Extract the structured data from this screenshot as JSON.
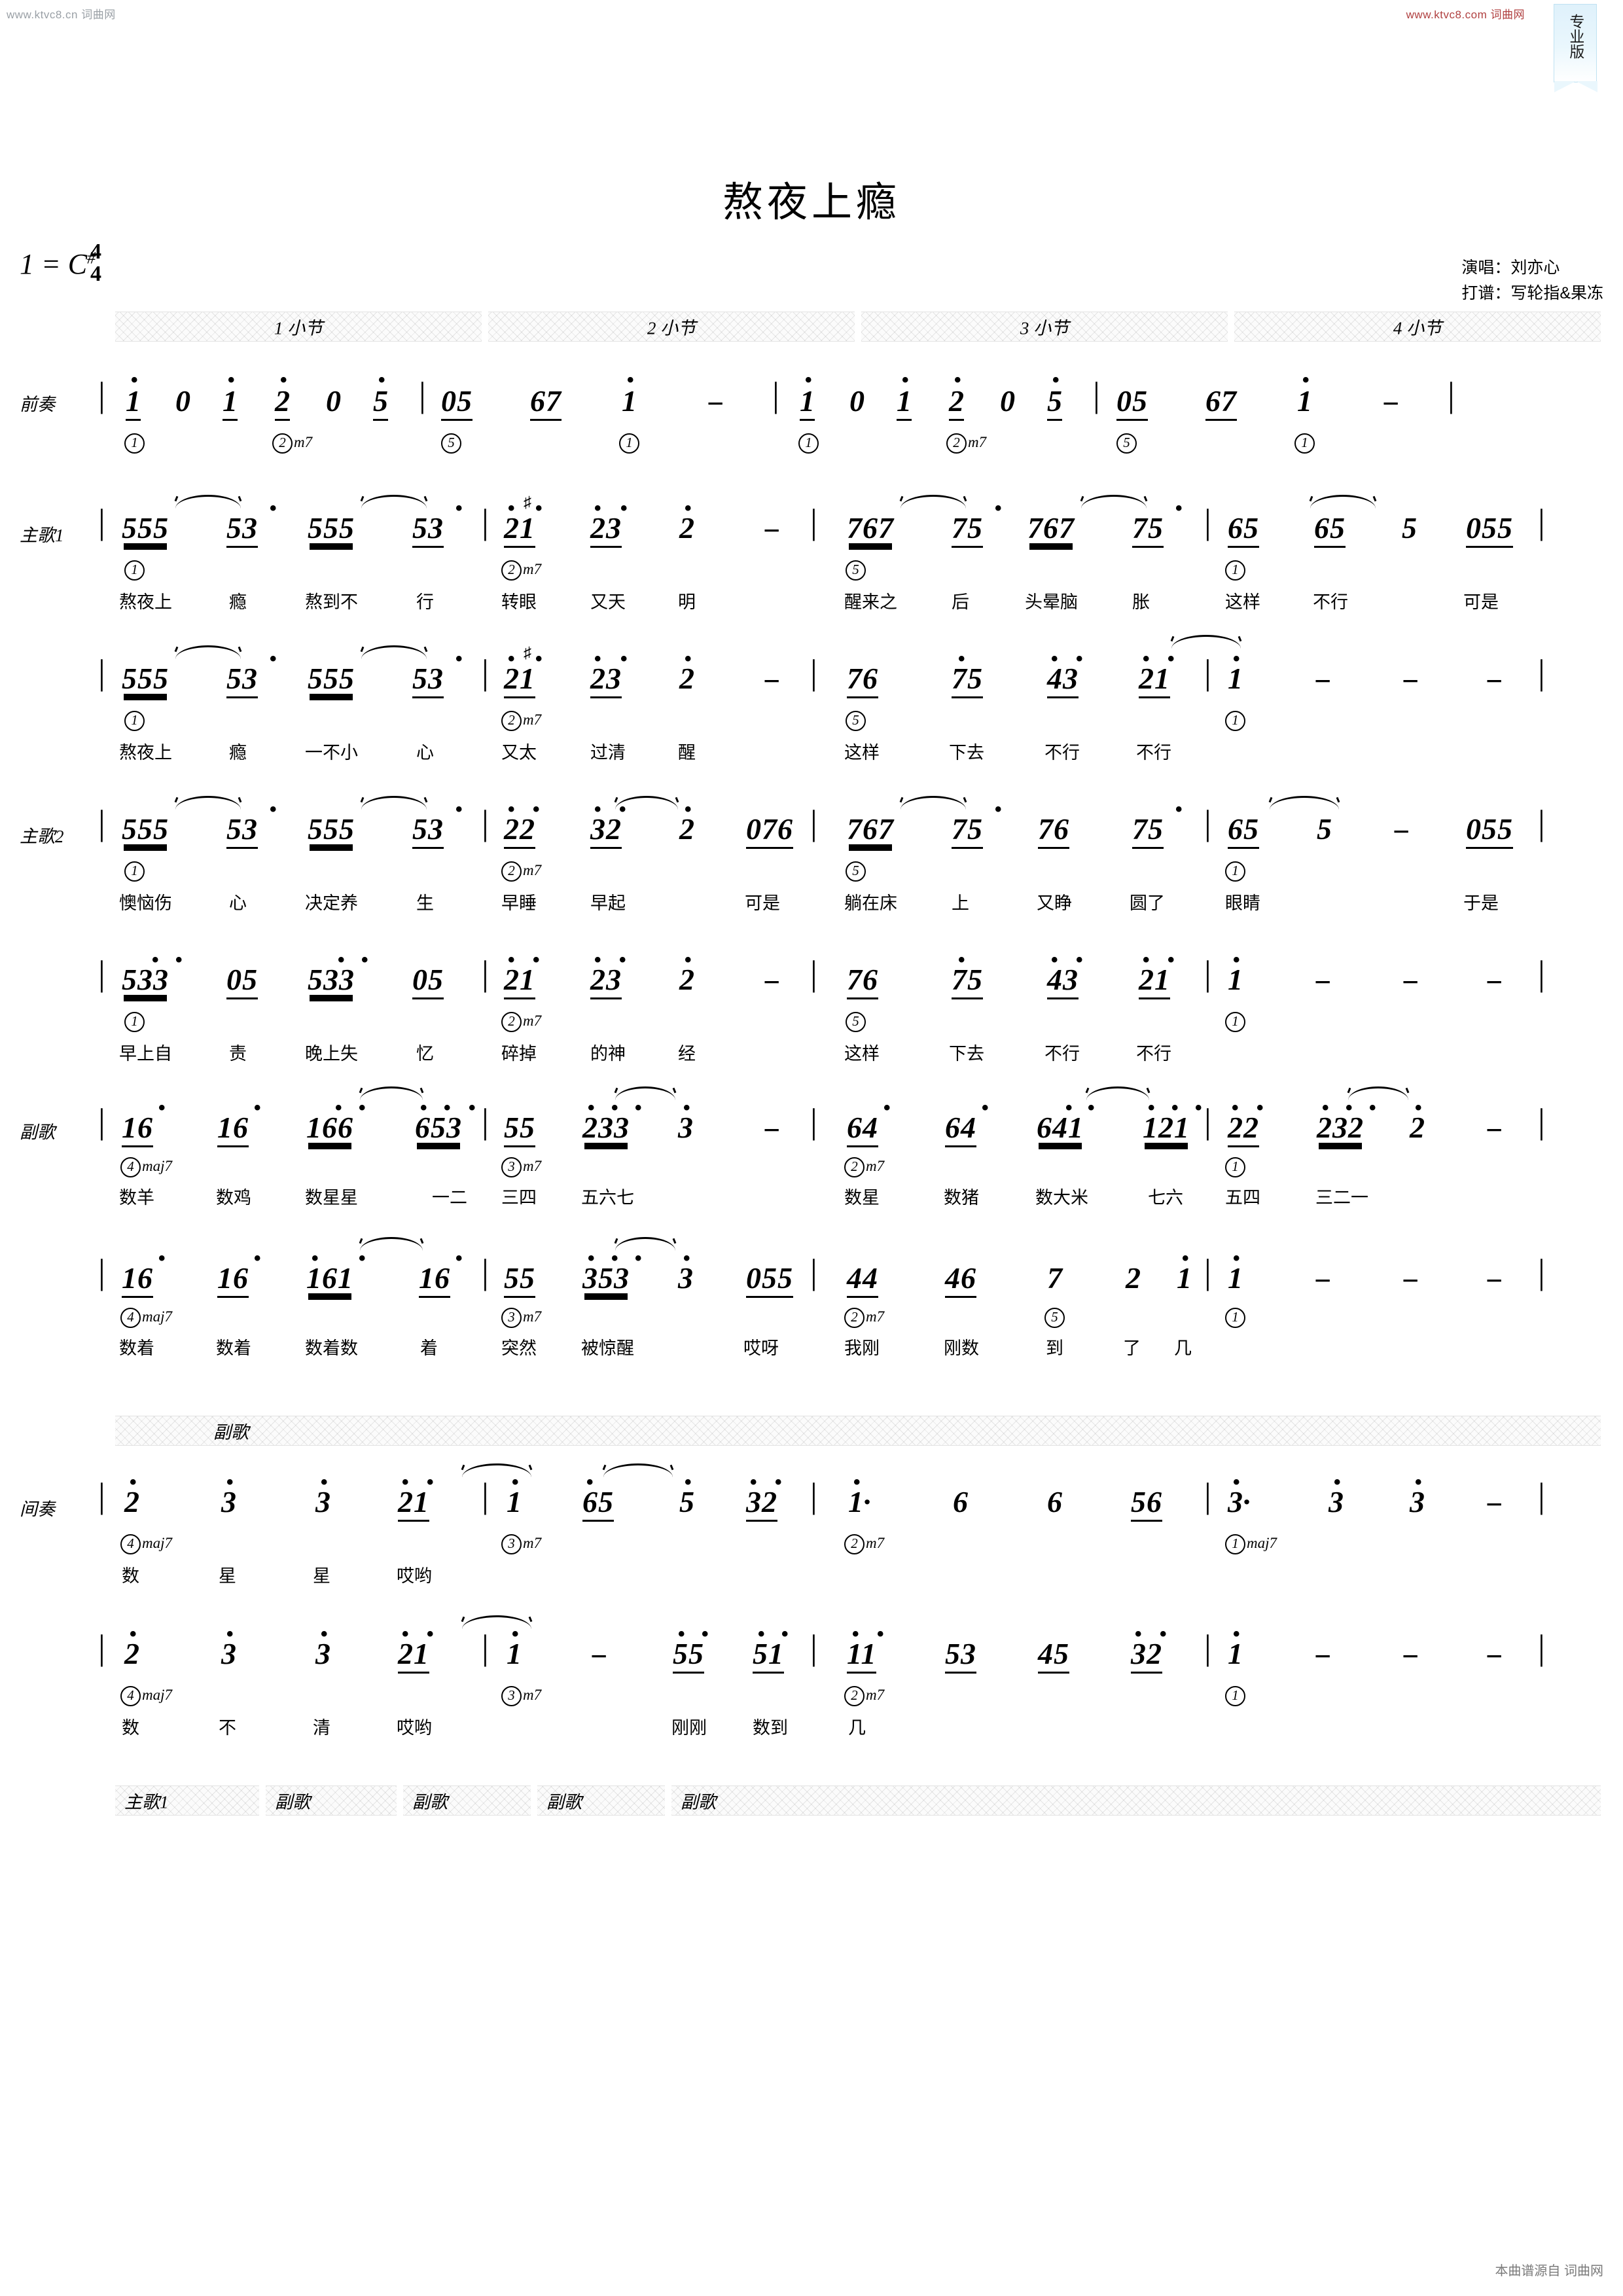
{
  "watermarks": {
    "top_left": "www.ktvc8.cn 词曲网",
    "top_right": "www.ktvc8.com 词曲网",
    "footer": "本曲谱源自 词曲网"
  },
  "ribbon": {
    "label": "专业版"
  },
  "header": {
    "title": "熬夜上瘾",
    "key": "1 = C",
    "key_accidental": "#",
    "meter_top": "4",
    "meter_bottom": "4",
    "singer_line": "演唱：刘亦心",
    "transcriber_line": "打谱：写轮指&果冻"
  },
  "measure_strip_top": [
    "1 小节",
    "2 小节",
    "3 小节",
    "4 小节"
  ],
  "measure_strip_mid": [
    "副歌"
  ],
  "measure_strip_bottom": [
    "主歌1",
    "副歌",
    "副歌",
    "副歌",
    "副歌"
  ],
  "section_labels": {
    "intro": "前奏",
    "verse1": "主歌1",
    "verse2": "主歌2",
    "chorus": "副歌",
    "interlude": "间奏"
  },
  "chords": {
    "one": "①",
    "two_m7": "②m7",
    "three_m7": "③m7",
    "four_maj7": "④maj7",
    "five": "⑤",
    "one_maj7": "①maj7"
  },
  "systems": [
    {
      "id": "intro",
      "label": "前奏",
      "notes": "| i 0 i 2 0 5 | 05 67 i − | i 0 i 2 0 5 | 05 67 i − |",
      "chords": [
        "①",
        "②m7",
        "⑤",
        "①",
        "①",
        "②m7",
        "⑤",
        "①"
      ],
      "lyrics": []
    },
    {
      "id": "verse1-a",
      "label": "主歌1",
      "notes": "| 555 53 555 53 | 21 23 2 − | 767 75 767 75 | 65 65 5 055 |",
      "chords": [
        "①",
        "②m7",
        "⑤",
        "①"
      ],
      "lyrics": [
        "熬夜上",
        "瘾",
        "熬到不",
        "行",
        "转眼",
        "又天",
        "明",
        "醒来之",
        "后",
        "头晕脑",
        "胀",
        "这样",
        "不行",
        "可是"
      ]
    },
    {
      "id": "verse1-b",
      "label": "",
      "notes": "| 555 53 555 53 | 21 23 2 − | 76 75 43 21 | 1 − − − |",
      "chords": [
        "①",
        "②m7",
        "⑤",
        "①"
      ],
      "lyrics": [
        "熬夜上",
        "瘾",
        "一不小",
        "心",
        "又太",
        "过清",
        "醒",
        "这样",
        "下去",
        "不行",
        "不行"
      ]
    },
    {
      "id": "verse2-a",
      "label": "主歌2",
      "notes": "| 555 53 555 53 | 22 32 2 076 | 767 75 76 75 | 65 5 − 055 |",
      "chords": [
        "①",
        "②m7",
        "⑤",
        "①"
      ],
      "lyrics": [
        "懊恼伤",
        "心",
        "决定养",
        "生",
        "早睡",
        "早起",
        "可是",
        "躺在床",
        "上",
        "又睁",
        "圆了",
        "眼睛",
        "于是"
      ]
    },
    {
      "id": "verse2-b",
      "label": "",
      "notes": "| 533 05 533 05 | 21 23 2 − | 76 75 43 21 | 1 − − − |",
      "chords": [
        "①",
        "②m7",
        "⑤",
        "①"
      ],
      "lyrics": [
        "早上自",
        "责",
        "晚上失",
        "忆",
        "碎掉",
        "的神",
        "经",
        "这样",
        "下去",
        "不行",
        "不行"
      ]
    },
    {
      "id": "chorus-a",
      "label": "副歌",
      "notes": "| 16 16 166 653 | 55 233 3 − | 64 64 641 121 | 22 232 2 − |",
      "chords": [
        "④maj7",
        "③m7",
        "②m7",
        "①"
      ],
      "lyrics": [
        "数羊",
        "数鸡",
        "数星星",
        "一二",
        "三四",
        "五六七",
        "数星",
        "数猪",
        "数大米",
        "七六",
        "五四",
        "三二一"
      ]
    },
    {
      "id": "chorus-b",
      "label": "",
      "notes": "| 16 16 161 16 | 55 353 3 055 | 44 46 7 2 1 | 1 − − − |",
      "chords": [
        "④maj7",
        "③m7",
        "②m7",
        "⑤",
        "①"
      ],
      "lyrics": [
        "数着",
        "数着",
        "数着数",
        "着",
        "突然",
        "被惊醒",
        "哎呀",
        "我刚",
        "刚数",
        "到",
        "了",
        "几"
      ]
    },
    {
      "id": "interlude-a",
      "label": "间奏",
      "notes": "| 2 3 3 21 | 1 65 5 32 | 1· 6 6 56 | 3· 3 3 − |",
      "chords": [
        "④maj7",
        "③m7",
        "②m7",
        "①maj7"
      ],
      "lyrics": [
        "数",
        "星",
        "星",
        "哎哟"
      ]
    },
    {
      "id": "interlude-b",
      "label": "",
      "notes": "| 2 3 3 21 | 1 − 55 51 | 11 53 45 32 | 1 − − − |",
      "chords": [
        "④maj7",
        "③m7",
        "②m7",
        "①"
      ],
      "lyrics": [
        "数",
        "不",
        "清",
        "哎哟",
        "刚刚",
        "数到",
        "几"
      ]
    }
  ]
}
